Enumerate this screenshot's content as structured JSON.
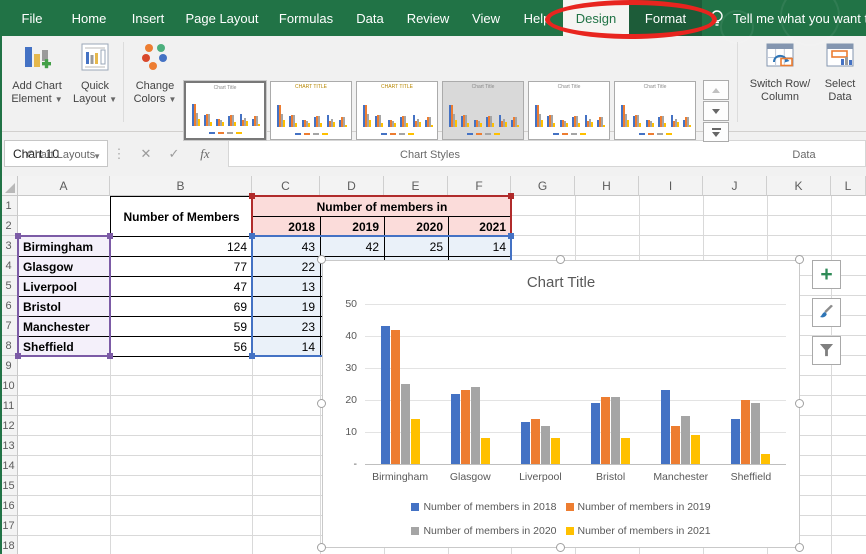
{
  "titlebar": {
    "tabs": [
      "File",
      "Home",
      "Insert",
      "Page Layout",
      "Formulas",
      "Data",
      "Review",
      "View",
      "Help",
      "Design",
      "Format"
    ],
    "active_tab": "Design",
    "tell_me": "Tell me what you want to"
  },
  "ribbon": {
    "add_chart_element": {
      "line1": "Add Chart",
      "line2": "Element"
    },
    "quick_layout": {
      "line1": "Quick",
      "line2": "Layout"
    },
    "chart_layouts_label": "Chart Layouts",
    "change_colors": {
      "line1": "Change",
      "line2": "Colors"
    },
    "chart_styles_label": "Chart Styles",
    "gallery_thumb_titles": [
      "Chart Title",
      "CHART TITLE",
      "CHART TITLE",
      "Chart Title",
      "Chart Title",
      "Chart Title"
    ],
    "switch_row_column": {
      "line1": "Switch Row/",
      "line2": "Column"
    },
    "select_data": {
      "line1": "Select",
      "line2": "Data"
    },
    "data_label": "Data"
  },
  "formula_bar": {
    "name_box_value": "Chart 10",
    "fx_label": "fx"
  },
  "sheet": {
    "column_headers": [
      "A",
      "B",
      "C",
      "D",
      "E",
      "F",
      "G",
      "H",
      "I",
      "J",
      "K",
      "L"
    ],
    "row_count": 18,
    "table": {
      "members_header": "Number of Members",
      "group_header": "Number of members in",
      "years": [
        "2018",
        "2019",
        "2020",
        "2021"
      ],
      "rows": [
        {
          "city": "Birmingham",
          "members": "124",
          "y2018": "43"
        },
        {
          "city": "Glasgow",
          "members": "77",
          "y2018": "22"
        },
        {
          "city": "Liverpool",
          "members": "47",
          "y2018": "13"
        },
        {
          "city": "Bristol",
          "members": "69",
          "y2018": "19"
        },
        {
          "city": "Manchester",
          "members": "59",
          "y2018": "23"
        },
        {
          "city": "Sheffield",
          "members": "56",
          "y2018": "14"
        }
      ],
      "row3_visible_values": [
        "42",
        "25",
        "14"
      ],
      "highlight_colors": {
        "header_range_border": "#b02b2b",
        "header_range_fill": "#fbdcda",
        "category_range_border": "#7c5ba6",
        "category_range_fill": "#f4f0fa",
        "data_range_border": "#4472c4",
        "data_range_fill": "#eaf1f9"
      }
    }
  },
  "chart_data": {
    "type": "bar",
    "title": "Chart Title",
    "categories": [
      "Birmingham",
      "Glasgow",
      "Liverpool",
      "Bristol",
      "Manchester",
      "Sheffield"
    ],
    "series": [
      {
        "name": "Number of members in 2018",
        "color": "#4472C4",
        "values": [
          43,
          22,
          13,
          19,
          23,
          14
        ]
      },
      {
        "name": "Number of members in 2019",
        "color": "#ED7D31",
        "values": [
          42,
          23,
          14,
          21,
          12,
          20
        ]
      },
      {
        "name": "Number of members in 2020",
        "color": "#A5A5A5",
        "values": [
          25,
          24,
          12,
          21,
          15,
          19
        ]
      },
      {
        "name": "Number of members in 2021",
        "color": "#FFC000",
        "values": [
          14,
          8,
          8,
          8,
          9,
          3
        ]
      }
    ],
    "ylim": [
      0,
      50
    ],
    "y_tick_labels": [
      "50",
      "40",
      "30",
      "20",
      "10",
      "-"
    ],
    "grid": "horizontal",
    "legend_position": "bottom"
  }
}
